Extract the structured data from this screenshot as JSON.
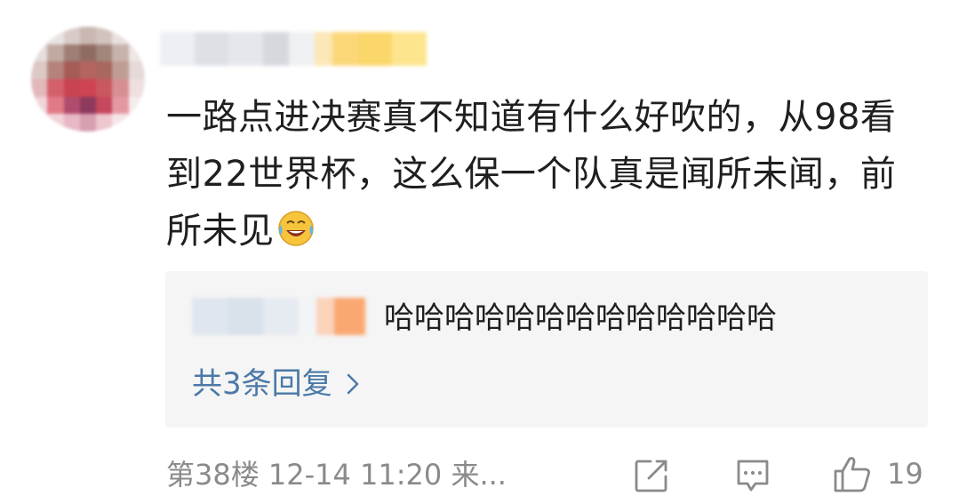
{
  "comment": {
    "text": "一路点进决赛真不知道有什么好吹的，从98看到22世界杯，这么保一个队真是闻所未闻，前所未见",
    "emoji_icon": "laughing-crying-emoji"
  },
  "reply": {
    "text": "哈哈哈哈哈哈哈哈哈哈哈哈哈",
    "more_label": "共3条回复"
  },
  "footer": {
    "meta": "第38楼 12-14 11:20 来...",
    "like_count": "19",
    "icons": [
      "share-icon",
      "comment-icon",
      "thumbs-up-icon"
    ]
  },
  "colors": {
    "link": "#4b79a8",
    "muted": "#8a8a8a",
    "reply_bg": "#f5f5f5"
  }
}
